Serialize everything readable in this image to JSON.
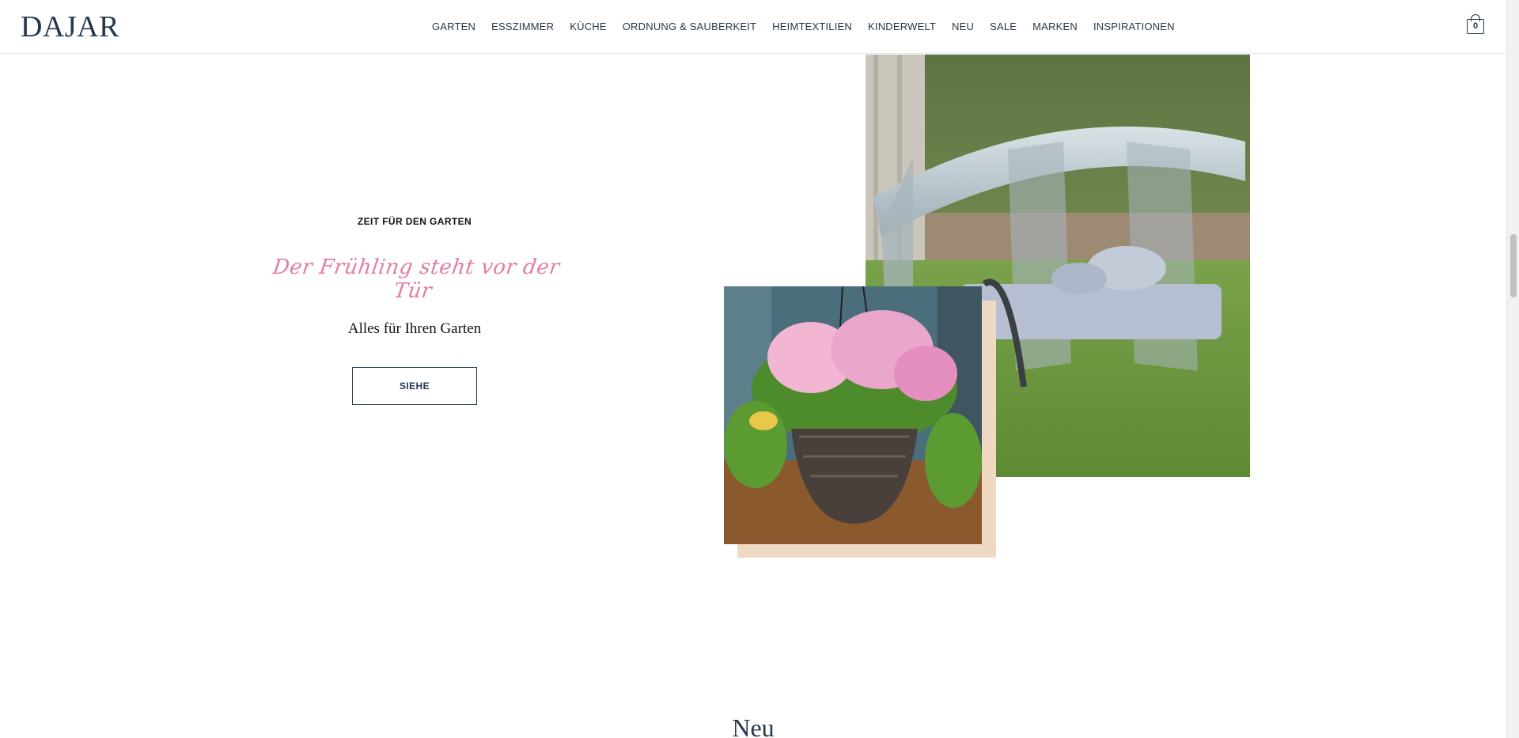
{
  "header": {
    "logo": "DAJAR",
    "nav": [
      "GARTEN",
      "ESSZIMMER",
      "KÜCHE",
      "ORDNUNG & SAUBERKEIT",
      "HEIMTEXTILIEN",
      "KINDERWELT",
      "NEU",
      "SALE",
      "MARKEN",
      "INSPIRATIONEN"
    ],
    "cart_count": "0",
    "cart_icon": "shopping-bag-icon"
  },
  "hero": {
    "eyebrow": "ZEIT FÜR DEN GARTEN",
    "script_title": "Der Frühling steht vor der Tür",
    "subtitle": "Alles für Ihren Garten",
    "cta_label": "SIEHE",
    "accent_color": "#e47ba3",
    "images": [
      "garden-swing-image",
      "hanging-flower-basket-image"
    ]
  },
  "sections": {
    "new_title": "Neu"
  }
}
